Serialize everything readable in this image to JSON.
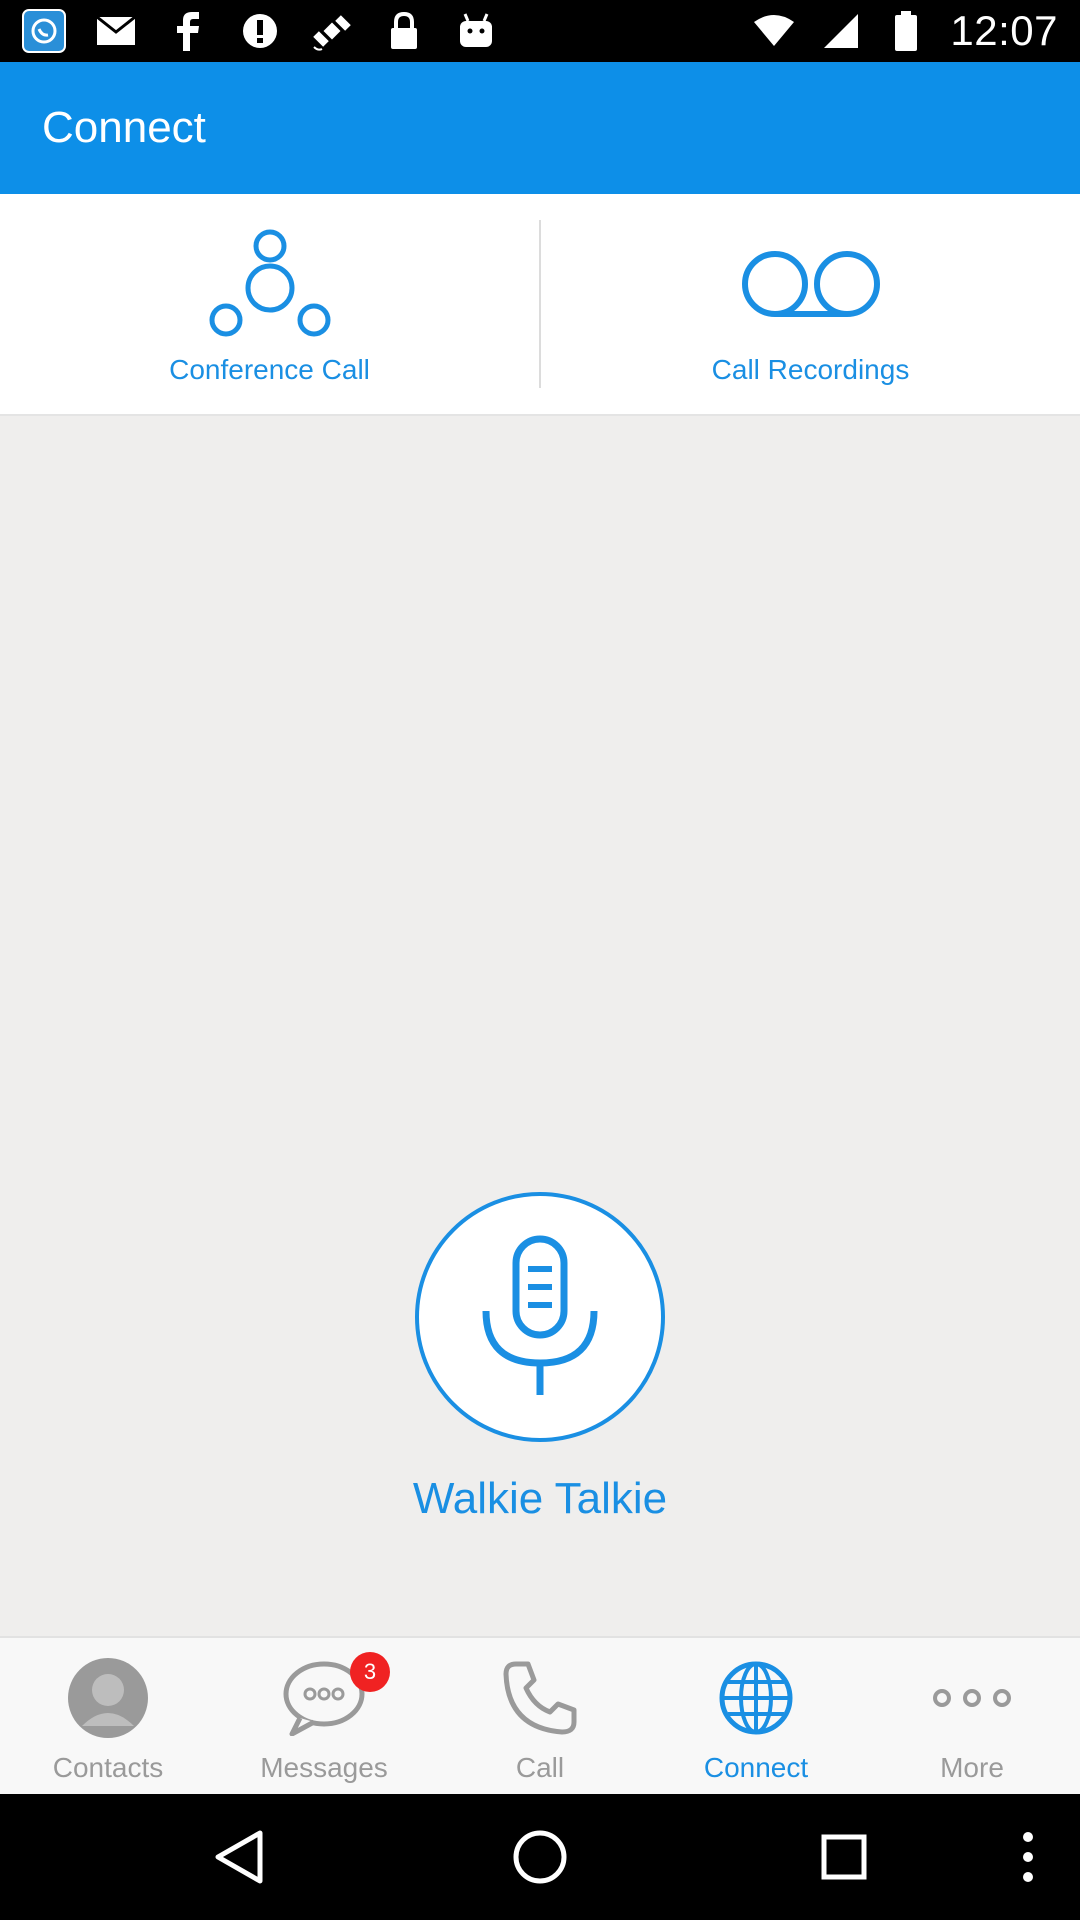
{
  "status_bar": {
    "time": "12:07",
    "icons": [
      "app-icon",
      "mail-icon",
      "facebook-icon",
      "info-icon",
      "satellite-icon",
      "lock-icon",
      "android-icon"
    ]
  },
  "app_bar": {
    "title": "Connect"
  },
  "features": [
    {
      "label": "Conference Call",
      "icon": "conference-icon"
    },
    {
      "label": "Call Recordings",
      "icon": "voicemail-icon"
    }
  ],
  "walkie": {
    "label": "Walkie Talkie",
    "icon": "microphone-icon"
  },
  "tabs": [
    {
      "label": "Contacts",
      "icon": "person-icon",
      "active": false
    },
    {
      "label": "Messages",
      "icon": "chat-icon",
      "active": false,
      "badge": "3"
    },
    {
      "label": "Call",
      "icon": "phone-icon",
      "active": false
    },
    {
      "label": "Connect",
      "icon": "globe-icon",
      "active": true
    },
    {
      "label": "More",
      "icon": "more-dots-icon",
      "active": false
    }
  ],
  "nav": [
    "back-icon",
    "home-icon",
    "recents-icon",
    "menu-icon"
  ],
  "colors": {
    "accent": "#0d8fe8",
    "text_accent": "#1a8fe3",
    "badge": "#f02222",
    "inactive": "#9a9a9a"
  }
}
